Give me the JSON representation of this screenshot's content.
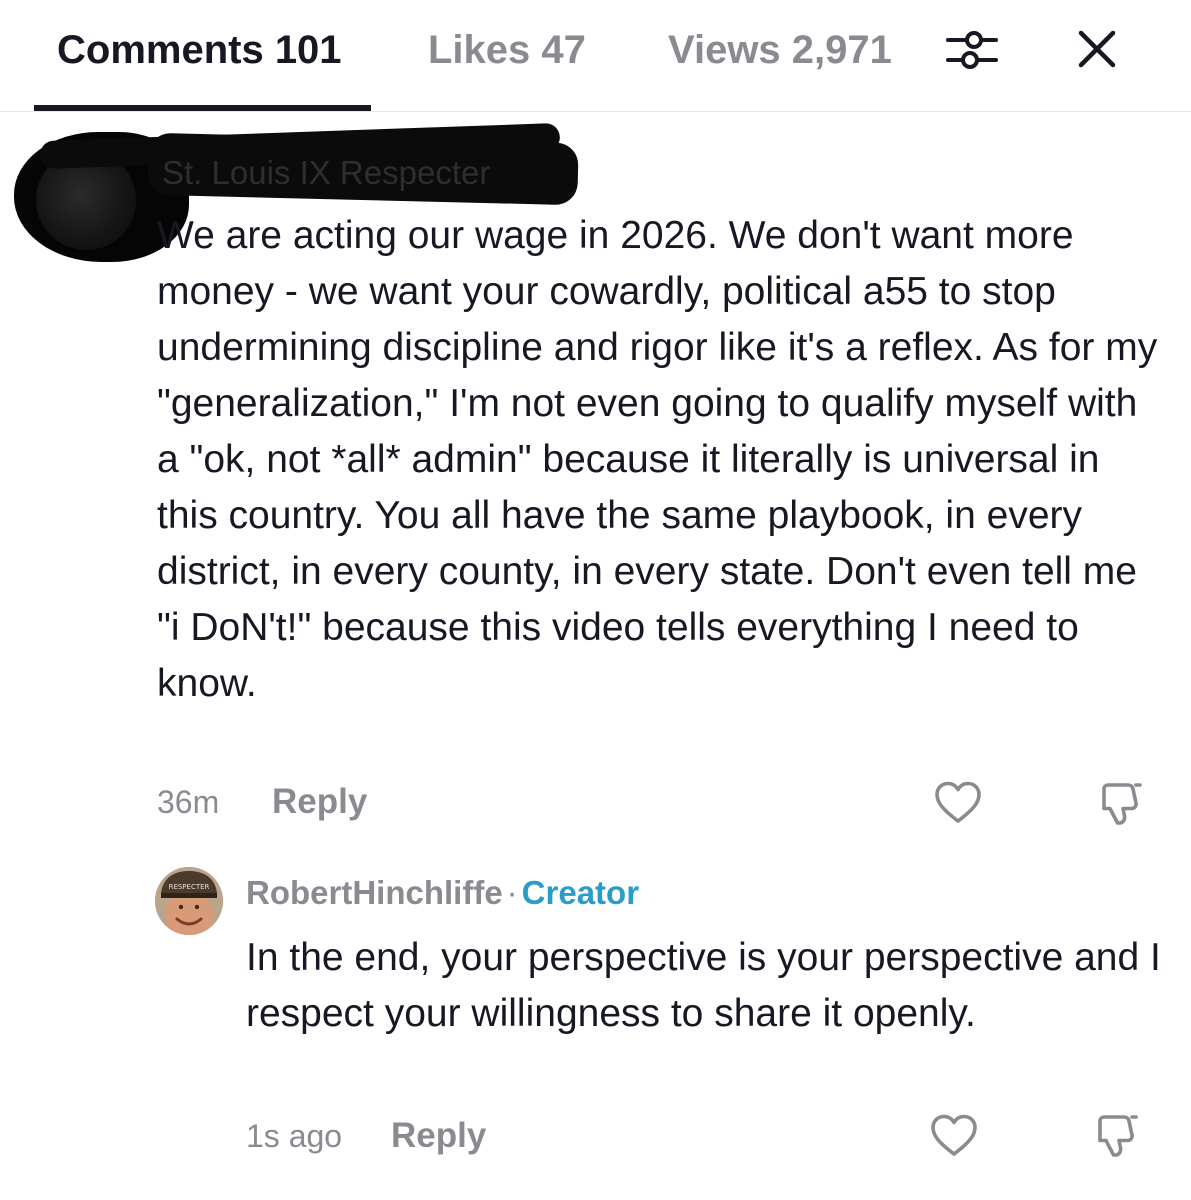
{
  "tabs": {
    "comments": "Comments 101",
    "likes": "Likes 47",
    "views": "Views 2,971"
  },
  "icons": {
    "filter": "sliders-icon",
    "close": "close-icon",
    "like": "heart-outline-icon",
    "dislike": "thumbs-down-outline-icon"
  },
  "comments": [
    {
      "username": "St. Louis IX Respecter",
      "text": "We are acting our wage in 2026. We don't want more money - we want your cowardly, political a55 to stop undermining discipline and rigor like it's a reflex. As for my \"generalization,\" I'm not even going to qualify myself with a \"ok, not *all* admin\" because it literally is universal in this country. You all have the same playbook, in every district, in every county, in every state. Don't even tell me \"i DoN't!\" because this video tells everything I need to know.",
      "time": "36m",
      "reply_label": "Reply",
      "replies": [
        {
          "username": "RobertHinchliffe",
          "separator": "·",
          "badge": "Creator",
          "avatar_cap_text": "RESPECTER",
          "text": "In the end, your perspective is your perspective and I respect your willingness to share it openly.",
          "time": "1s ago",
          "reply_label": "Reply"
        }
      ]
    }
  ],
  "colors": {
    "primary_text": "#161823",
    "secondary_text": "#8a8b91",
    "creator_badge": "#2a9cc8",
    "divider": "#e4e4e6"
  }
}
